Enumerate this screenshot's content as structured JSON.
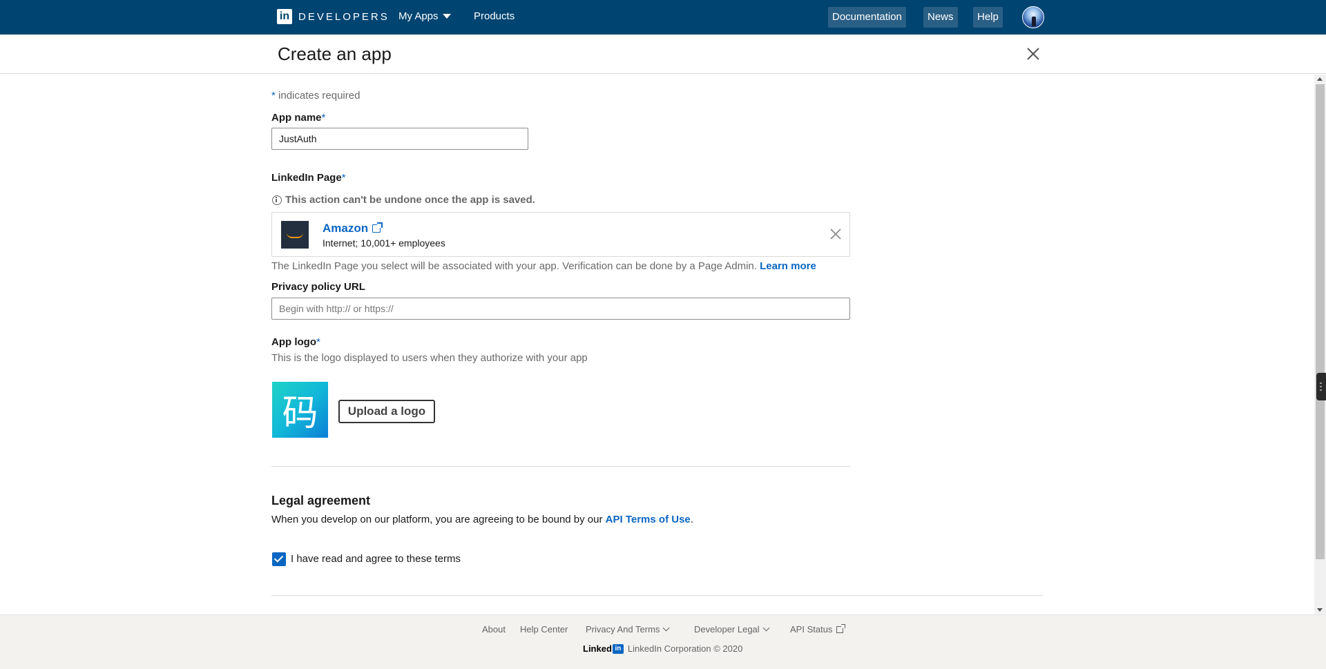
{
  "topnav": {
    "brand_mark": "in",
    "brand_text": "DEVELOPERS",
    "my_apps": "My Apps",
    "products": "Products",
    "documentation": "Documentation",
    "news": "News",
    "help": "Help"
  },
  "header": {
    "title": "Create an app"
  },
  "form": {
    "required_asterisk": "*",
    "required_note": "indicates required",
    "app_name_label": "App name",
    "app_name_value": "JustAuth",
    "linkedin_page_label": "LinkedIn Page",
    "page_warning": "This action can't be undone once the app is saved.",
    "selected_page": {
      "name": "Amazon",
      "meta": "Internet; 10,001+ employees"
    },
    "page_helper": "The LinkedIn Page you select will be associated with your app. Verification can be done by a Page Admin.",
    "learn_more": "Learn more",
    "privacy_label": "Privacy policy URL",
    "privacy_placeholder": "Begin with http:// or https://",
    "logo_label": "App logo",
    "logo_helper": "This is the logo displayed to users when they authorize with your app",
    "logo_glyph": "码",
    "upload_button": "Upload a logo"
  },
  "legal": {
    "heading": "Legal agreement",
    "text_prefix": "When you develop on our platform, you are agreeing to be bound by our",
    "terms_link": "API Terms of Use",
    "text_suffix": ".",
    "checkbox_label": "I have read and agree to these terms",
    "checkbox_checked": true
  },
  "footer": {
    "links": [
      "About",
      "Help Center",
      "Privacy And Terms",
      "Developer Legal",
      "API Status"
    ],
    "brand_word": "Linked",
    "brand_box": "in",
    "copyright": "LinkedIn Corporation © 2020"
  },
  "colors": {
    "nav_bg": "#004471",
    "link_blue": "#0a66c2",
    "footer_bg": "#f3f2ef"
  }
}
